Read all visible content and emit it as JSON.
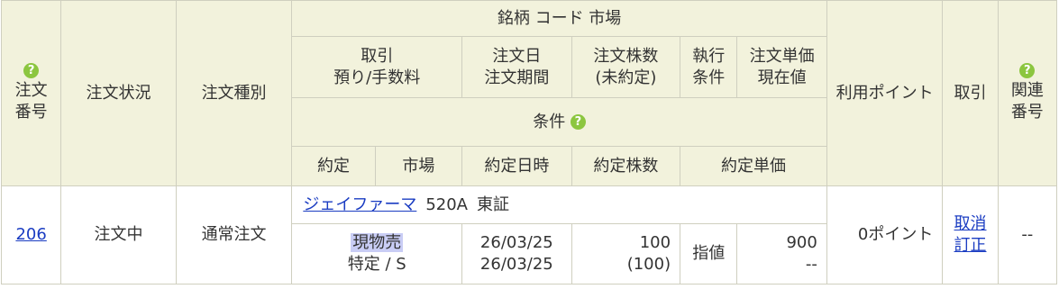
{
  "headers": {
    "order_no": "注文番号",
    "order_status": "注文状況",
    "order_type": "注文種別",
    "stock": "銘柄 コード 市場",
    "trade_line1": "取引",
    "trade_line2": "預り/手数料",
    "order_date_line1": "注文日",
    "order_date_line2": "注文期間",
    "qty_line1": "注文株数",
    "qty_line2": "(未約定)",
    "exec_line1": "執行",
    "exec_line2": "条件",
    "price_line1": "注文単価",
    "price_line2": "現在値",
    "conditions": "条件",
    "fill": "約定",
    "market": "市場",
    "fill_datetime": "約定日時",
    "fill_qty": "約定株数",
    "fill_price": "約定単価",
    "points": "利用ポイント",
    "action": "取引",
    "related_line1": "関連",
    "related_line2": "番号"
  },
  "help_icon_glyph": "?",
  "order": {
    "number": "206",
    "status": "注文中",
    "type": "通常注文",
    "stock_name": "ジェイファーマ",
    "code": "520A",
    "market": "東証",
    "trade": "現物売",
    "account": "特定 / S",
    "order_date": "26/03/25",
    "period": "26/03/25",
    "qty": "100",
    "unfilled": "(100)",
    "exec_condition": "指値",
    "price": "900",
    "current_price": "--",
    "points": "0ポイント",
    "cancel": "取消",
    "amend": "訂正",
    "related": "--"
  },
  "colors": {
    "header_bg": "#f2f2dc",
    "border": "#cfcfbf",
    "link": "#1a3cc2",
    "help_icon": "#8cc63f",
    "sell_highlight": "#c9cdf5"
  }
}
